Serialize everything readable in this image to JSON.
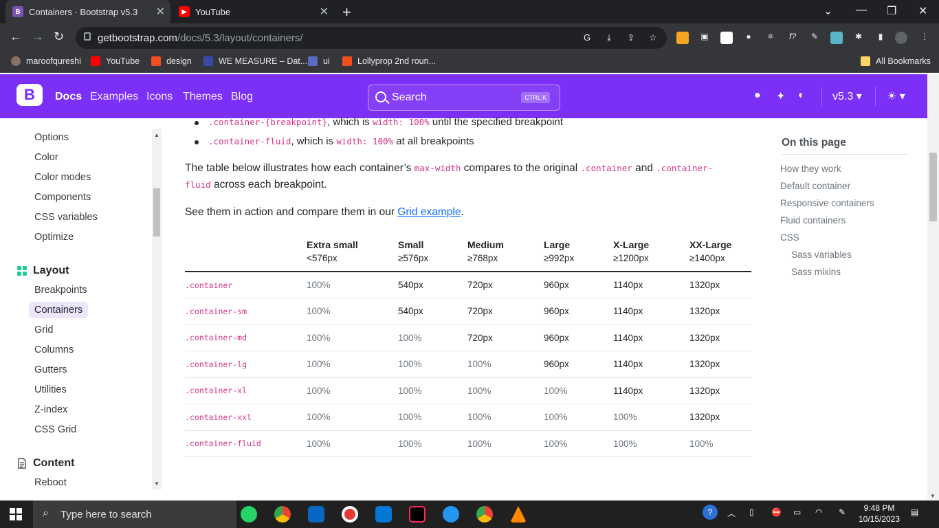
{
  "browser": {
    "tabs": [
      {
        "title": "Containers · Bootstrap v5.3",
        "favicon": "bootstrap-icon"
      },
      {
        "title": "YouTube",
        "favicon": "youtube-icon"
      }
    ],
    "url_domain": "getbootstrap.com",
    "url_path": "/docs/5.3/layout/containers/",
    "bookmarks": [
      "maroofqureshi",
      "YouTube",
      "design",
      "WE MEASURE – Dat...",
      "ui",
      "Lollyprop 2nd roun..."
    ],
    "all_bookmarks": "All Bookmarks"
  },
  "navbar": {
    "logo": "B",
    "links": [
      "Docs",
      "Examples",
      "Icons",
      "Themes",
      "Blog"
    ],
    "search_placeholder": "Search",
    "search_shortcut": "CTRL K",
    "version": "v5.3"
  },
  "sidebar": {
    "items_top": [
      "Options",
      "Color",
      "Color modes",
      "Components",
      "CSS variables",
      "Optimize"
    ],
    "section_layout": "Layout",
    "layout_items": [
      "Breakpoints",
      "Containers",
      "Grid",
      "Columns",
      "Gutters",
      "Utilities",
      "Z-index",
      "CSS Grid"
    ],
    "section_content": "Content",
    "content_items": [
      "Reboot"
    ]
  },
  "content": {
    "bullet1_code": ".container-{breakpoint}",
    "bullet1_mid": ", which is ",
    "bullet1_code2": "width: 100%",
    "bullet1_end": " until the specified breakpoint",
    "bullet2_code": ".container-fluid",
    "bullet2_mid": ", which is ",
    "bullet2_code2": "width: 100%",
    "bullet2_end": " at all breakpoints",
    "para1_a": "The table below illustrates how each container’s ",
    "para1_code1": "max-width",
    "para1_b": " compares to the original ",
    "para1_code2": ".container",
    "para1_c": " and ",
    "para1_code3": ".container-",
    "para1_code4": "fluid",
    "para1_d": " across each breakpoint.",
    "para2_a": "See them in action and compare them in our ",
    "para2_link": "Grid example",
    "para2_b": "."
  },
  "table": {
    "headers": [
      {
        "name": "",
        "sub": ""
      },
      {
        "name": "Extra small",
        "sub": "<576px"
      },
      {
        "name": "Small",
        "sub": "≥576px"
      },
      {
        "name": "Medium",
        "sub": "≥768px"
      },
      {
        "name": "Large",
        "sub": "≥992px"
      },
      {
        "name": "X-Large",
        "sub": "≥1200px"
      },
      {
        "name": "XX-Large",
        "sub": "≥1400px"
      }
    ],
    "rows": [
      [
        ".container",
        "100%",
        "540px",
        "720px",
        "960px",
        "1140px",
        "1320px"
      ],
      [
        ".container-sm",
        "100%",
        "540px",
        "720px",
        "960px",
        "1140px",
        "1320px"
      ],
      [
        ".container-md",
        "100%",
        "100%",
        "720px",
        "960px",
        "1140px",
        "1320px"
      ],
      [
        ".container-lg",
        "100%",
        "100%",
        "100%",
        "960px",
        "1140px",
        "1320px"
      ],
      [
        ".container-xl",
        "100%",
        "100%",
        "100%",
        "100%",
        "1140px",
        "1320px"
      ],
      [
        ".container-xxl",
        "100%",
        "100%",
        "100%",
        "100%",
        "100%",
        "1320px"
      ],
      [
        ".container-fluid",
        "100%",
        "100%",
        "100%",
        "100%",
        "100%",
        "100%"
      ]
    ]
  },
  "toc": {
    "title": "On this page",
    "items": [
      "How they work",
      "Default container",
      "Responsive containers",
      "Fluid containers",
      "CSS"
    ],
    "sub_items": [
      "Sass variables",
      "Sass mixins"
    ]
  },
  "taskbar": {
    "search_placeholder": "Type here to search",
    "time": "9:48 PM",
    "date": "10/15/2023"
  }
}
